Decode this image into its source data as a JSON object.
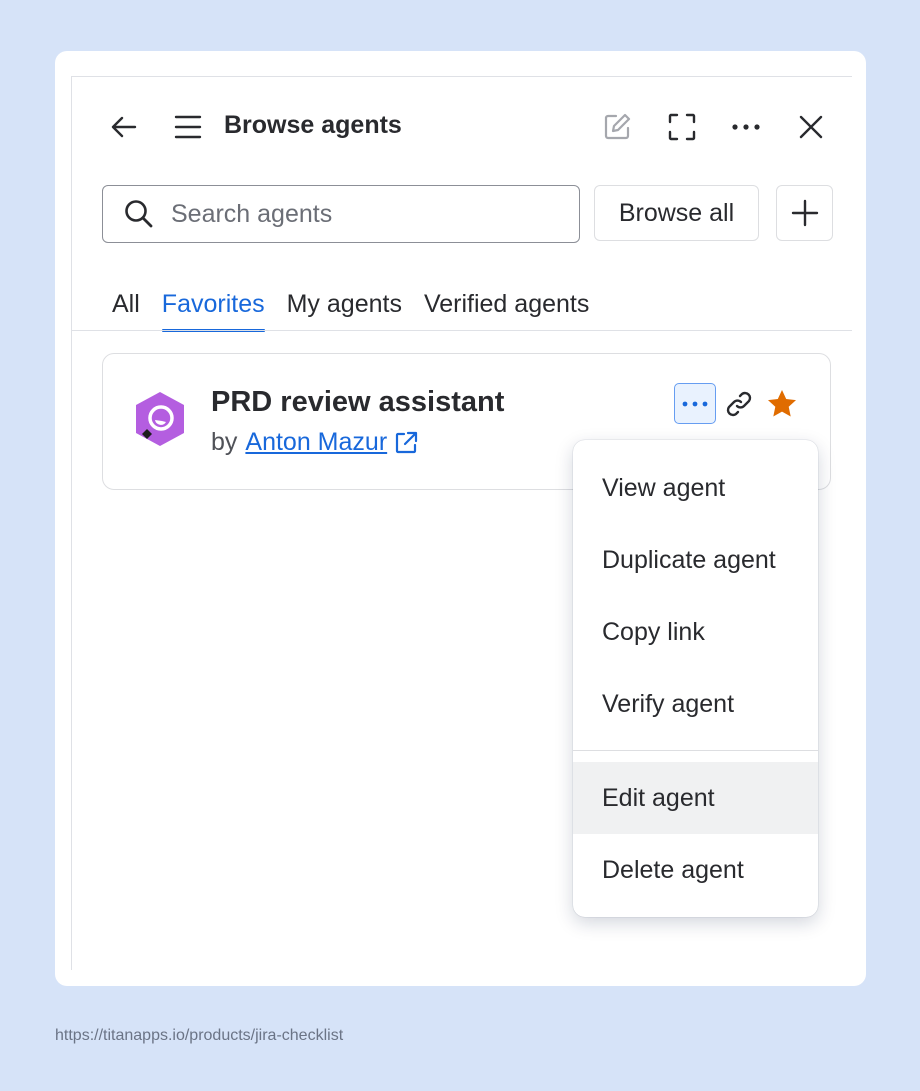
{
  "header": {
    "title": "Browse agents",
    "back_icon": "arrow-left-icon",
    "menu_icon": "hamburger-menu-icon",
    "edit_icon": "edit-icon",
    "fullscreen_icon": "fullscreen-icon",
    "more_icon": "more-horizontal-icon",
    "close_icon": "close-icon"
  },
  "search": {
    "placeholder": "Search agents",
    "value": ""
  },
  "toolbar": {
    "browse_all_label": "Browse all",
    "add_icon": "plus-icon"
  },
  "tabs": [
    {
      "label": "All",
      "active": false
    },
    {
      "label": "Favorites",
      "active": true
    },
    {
      "label": "My agents",
      "active": false
    },
    {
      "label": "Verified agents",
      "active": false
    }
  ],
  "agent": {
    "name": "PRD review assistant",
    "by_prefix": "by",
    "author": "Anton Mazur",
    "favorite": true
  },
  "menu": {
    "items": [
      {
        "label": "View agent"
      },
      {
        "label": "Duplicate agent"
      },
      {
        "label": "Copy link"
      },
      {
        "label": "Verify agent"
      },
      {
        "label": "Edit agent"
      },
      {
        "label": "Delete agent"
      }
    ],
    "hovered": "Edit agent"
  },
  "footer": {
    "url": "https://titanapps.io/products/jira-checklist"
  },
  "colors": {
    "background": "#d6e3f8",
    "accent": "#1868db",
    "star": "#e06c00",
    "avatar": "#b45ee0"
  }
}
